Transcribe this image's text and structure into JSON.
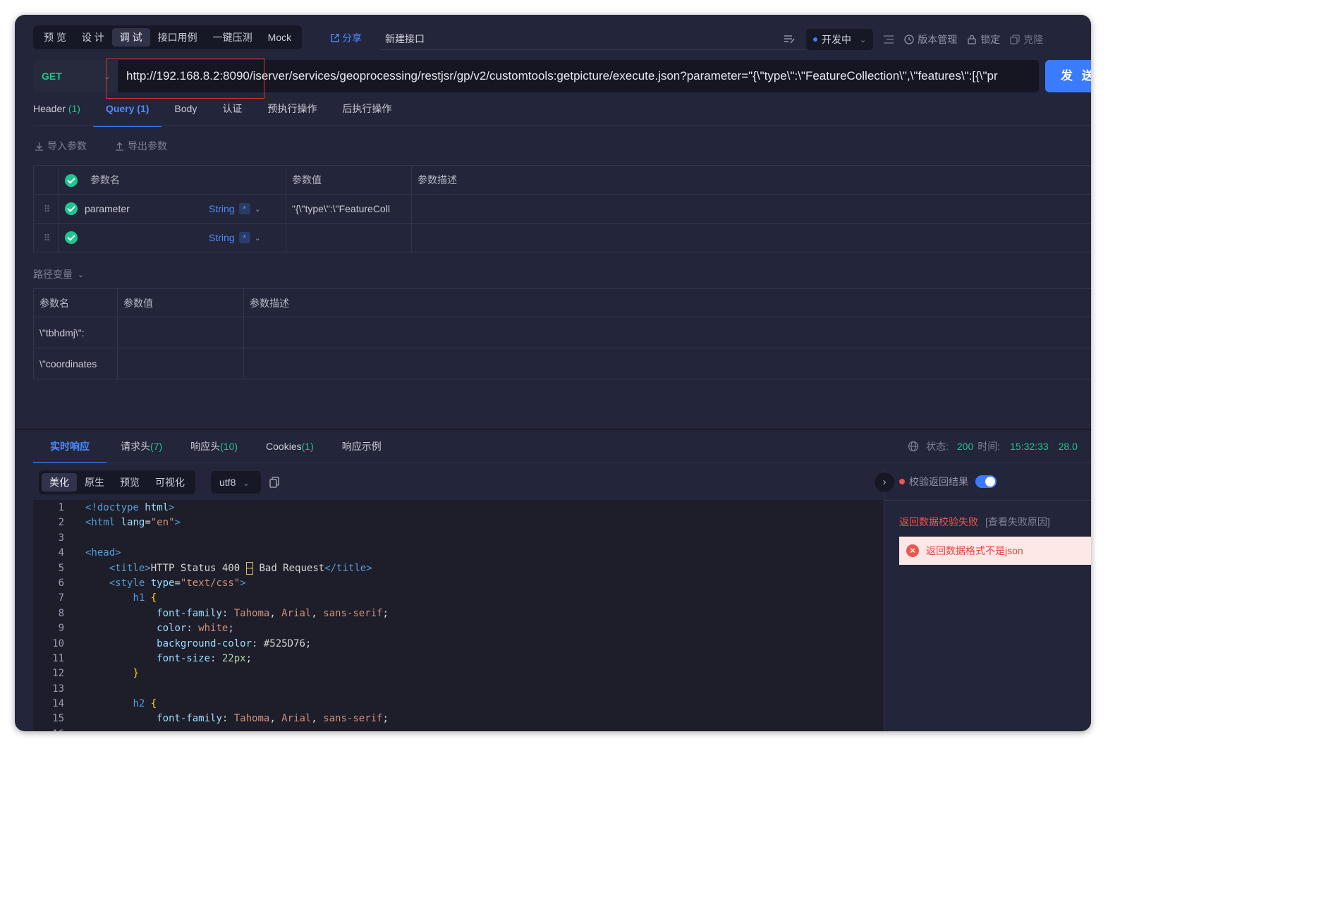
{
  "top_tabs": [
    "预 览",
    "设 计",
    "调 试",
    "接口用例",
    "一键压测",
    "Mock"
  ],
  "share_label": "分享",
  "api_name": "新建接口",
  "status_label": "开发中",
  "version_label": "版本管理",
  "lock_label": "锁定",
  "clone_label": "克隆",
  "method": "GET",
  "url": "http://192.168.8.2:8090/iserver/services/geoprocessing/restjsr/gp/v2/customtools:getpicture/execute.json?parameter=\"{\\\"type\\\":\\\"FeatureCollection\\\",\\\"features\\\":[{\\\"pr",
  "send_label": "发 送",
  "request_tabs": [
    {
      "label": "Header",
      "count": "(1)"
    },
    {
      "label": "Query",
      "count": "(1)"
    },
    {
      "label": "Body",
      "count": ""
    },
    {
      "label": "认证",
      "count": ""
    },
    {
      "label": "预执行操作",
      "count": ""
    },
    {
      "label": "后执行操作",
      "count": ""
    }
  ],
  "import_params": "导入参数",
  "export_params": "导出参数",
  "query_table": {
    "headers": [
      "参数名",
      "参数值",
      "参数描述"
    ],
    "rows": [
      {
        "name": "parameter",
        "type": "String",
        "required": "*",
        "value": "\"{\\\"type\\\":\\\"FeatureColl",
        "desc": ""
      },
      {
        "name": "",
        "type": "String",
        "required": "*",
        "value": "",
        "desc": ""
      }
    ]
  },
  "path_vars_label": "路径变量",
  "path_table": {
    "headers": [
      "参数名",
      "参数值",
      "参数描述"
    ],
    "rows": [
      {
        "name": "\\\"tbhdmj\\\":",
        "value": "",
        "desc": ""
      },
      {
        "name": "\\\"coordinates",
        "value": "",
        "desc": ""
      }
    ]
  },
  "response_tabs": [
    {
      "label": "实时响应",
      "count": ""
    },
    {
      "label": "请求头",
      "count": "(7)"
    },
    {
      "label": "响应头",
      "count": "(10)"
    },
    {
      "label": "Cookies",
      "count": "(1)"
    },
    {
      "label": "响应示例",
      "count": ""
    }
  ],
  "response_info": {
    "status_label": "状态:",
    "status_value": "200",
    "time_label": "时间:",
    "time_value": "15:32:33",
    "extra": "28.0"
  },
  "view_tabs": [
    "美化",
    "原生",
    "预览",
    "可视化"
  ],
  "encoding": "utf8",
  "verify_label": "校验返回结果",
  "verify_fail": "返回数据校验失败",
  "verify_reason_link": "[查看失败原因]",
  "error_message": "返回数据格式不是json",
  "code_lines": [
    "<!doctype html>",
    "<html lang=\"en\">",
    "",
    "<head>",
    "    <title>HTTP Status 400 – Bad Request</title>",
    "    <style type=\"text/css\">",
    "        h1 {",
    "            font-family: Tahoma, Arial, sans-serif;",
    "            color: white;",
    "            background-color: #525D76;",
    "            font-size: 22px;",
    "        }",
    "",
    "        h2 {",
    "            font-family: Tahoma, Arial, sans-serif;"
  ],
  "colors": {
    "accent": "#3a7bff",
    "success": "#1fc58f",
    "error": "#f0554f",
    "background": "#23253a"
  }
}
